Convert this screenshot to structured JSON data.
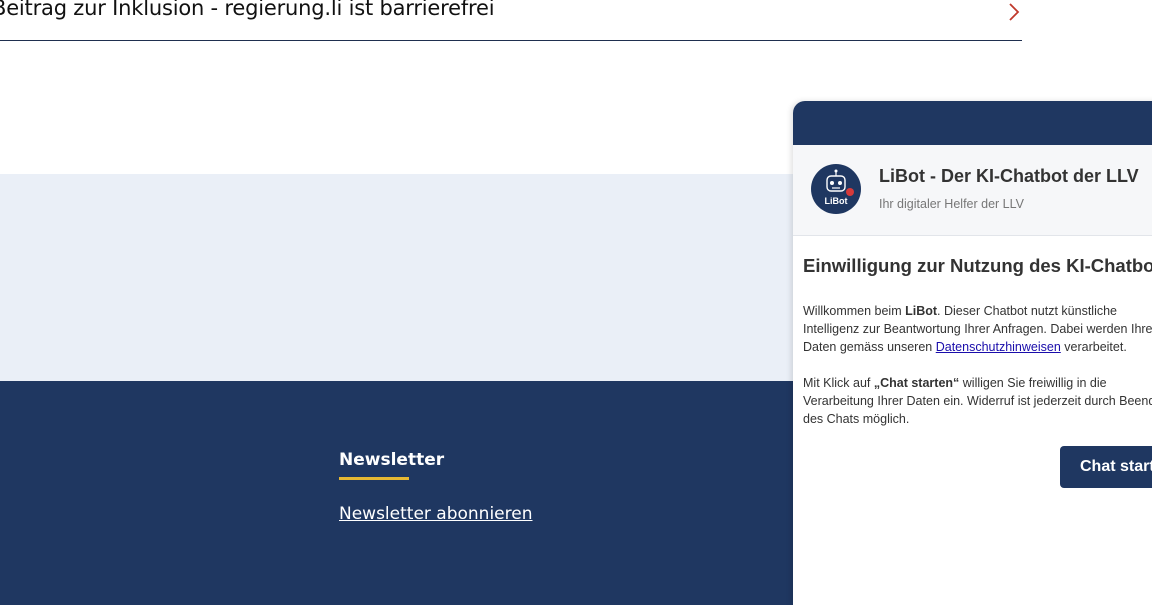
{
  "top_link": {
    "label": "Beitrag zur Inklusion - regierung.li ist barrierefrei",
    "icon": "chevron-right-icon",
    "accent_color": "#c0392b"
  },
  "footer": {
    "newsletter_title": "Newsletter",
    "newsletter_link": "Newsletter abonnieren",
    "background_color": "#1f3761",
    "underline_color": "#e6b833"
  },
  "chat": {
    "bot_name": "LiBot - Der KI-Chatbot der LLV",
    "bot_subtitle": "Ihr digitaler Helfer der LLV",
    "avatar_label": "LiBot",
    "avatar_icon": "robot-icon",
    "consent_title": "Einwilligung zur Nutzung des KI-Chatbots",
    "p1_prefix": "Willkommen beim ",
    "p1_bold": "LiBot",
    "p1_middle": ". Dieser Chatbot nutzt künstliche Intelligenz zur Beantwortung Ihrer Anfragen. Dabei werden Ihre Daten gemäss unseren ",
    "p1_link": "Datenschutzhinweisen",
    "p1_suffix": " verarbeitet.",
    "p2_prefix": "Mit Klick auf ",
    "p2_bold": "„Chat starten“",
    "p2_suffix": " willigen Sie freiwillig in die Verarbeitung Ihrer Daten ein. Widerruf ist jederzeit durch Beenden des Chats möglich.",
    "start_button": "Chat starten",
    "primary_color": "#1f3761"
  }
}
